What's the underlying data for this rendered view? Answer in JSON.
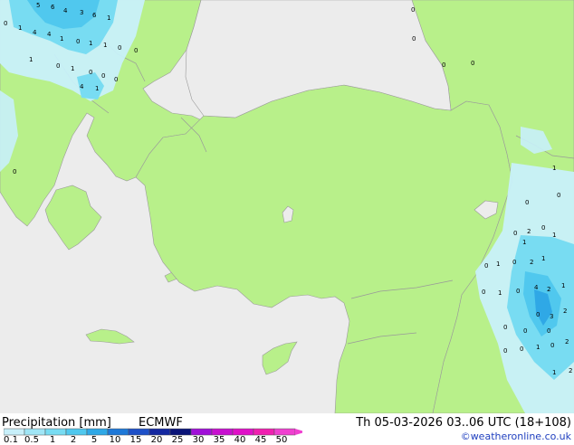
{
  "footer": {
    "title": "Precipitation [mm]",
    "model": "ECMWF",
    "valid_time": "Th 05-03-2026 03..06 UTC (18+108)",
    "credit": "©weatheronline.co.uk"
  },
  "legend": {
    "ticks": [
      "0.1",
      "0.5",
      "1",
      "2",
      "5",
      "10",
      "15",
      "20",
      "25",
      "30",
      "35",
      "40",
      "45",
      "50"
    ],
    "colors": [
      "#c8f0fa",
      "#a0e6f6",
      "#78dcf2",
      "#50c8ee",
      "#2fa8e6",
      "#1e78d8",
      "#1e50c8",
      "#1428a0",
      "#0a1478",
      "#a010d8",
      "#c810d0",
      "#e010c8",
      "#f020b0",
      "#f040d0"
    ]
  },
  "colors": {
    "sea": "#ececec",
    "land": "#b8f08a",
    "coast": "#9a9a9a",
    "border": "#999999"
  },
  "map_labels": [
    "0",
    "1",
    "2",
    "3",
    "4",
    "5",
    "6"
  ]
}
